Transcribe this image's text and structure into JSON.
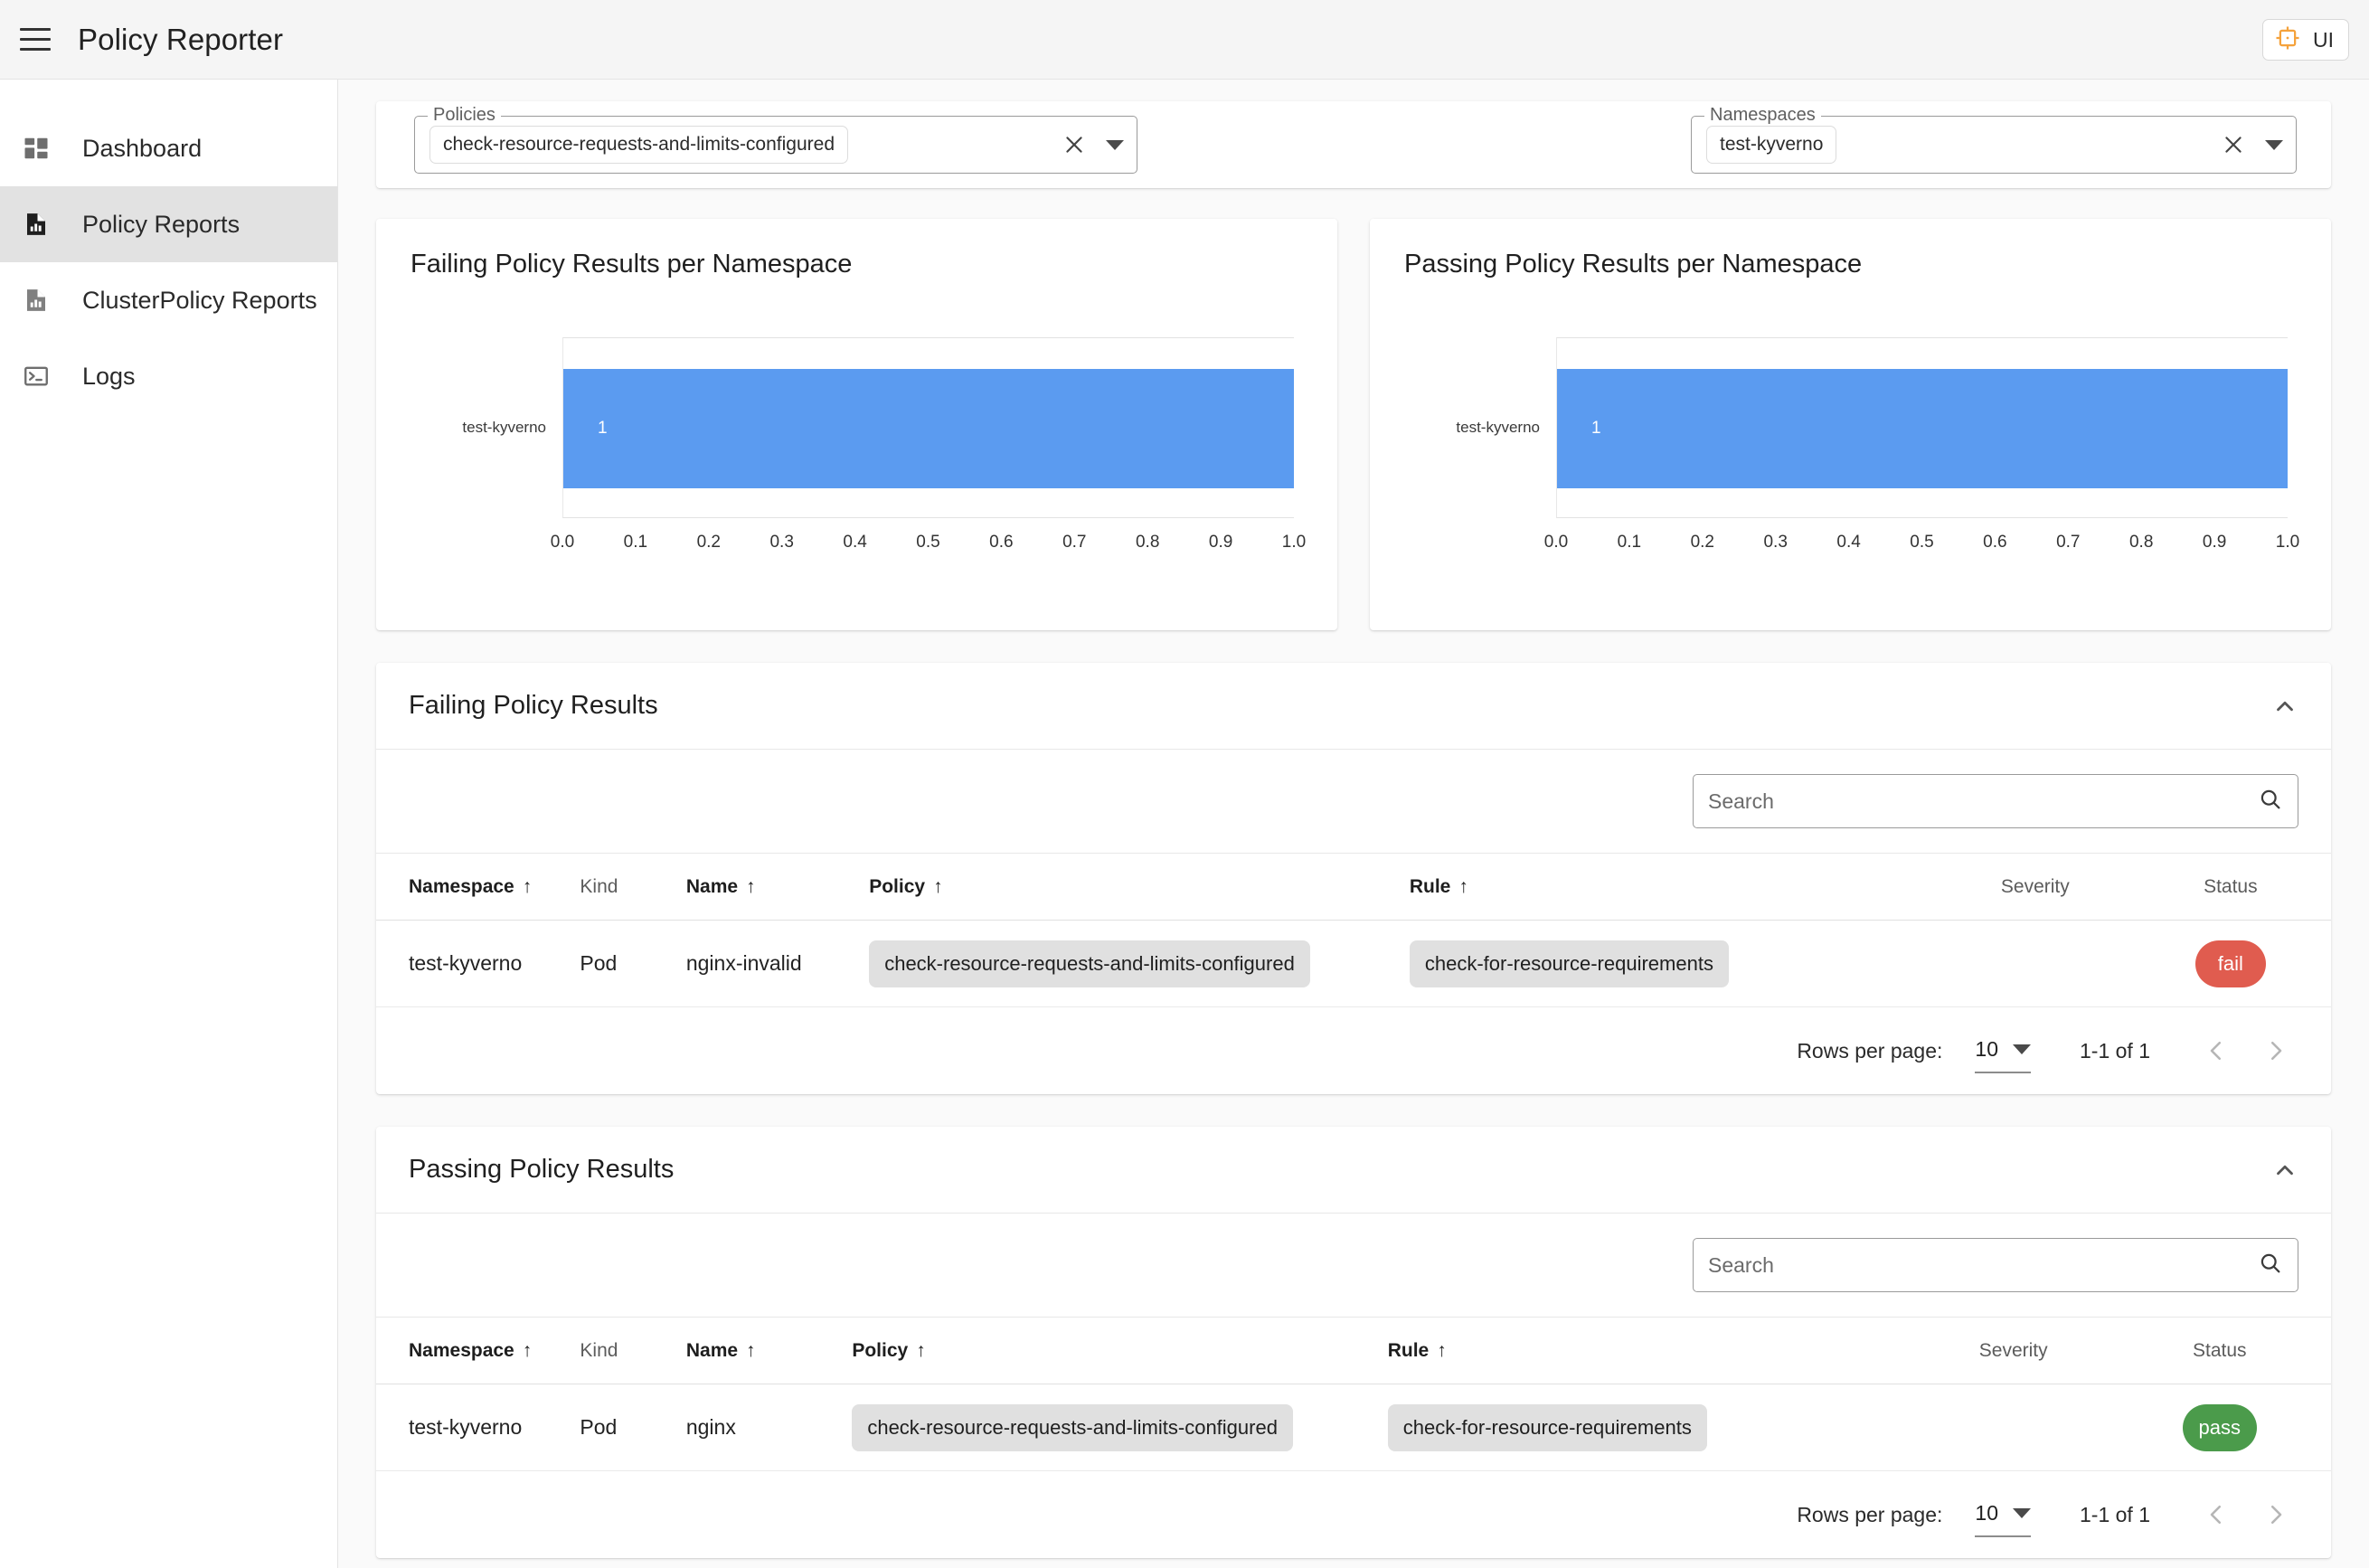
{
  "header": {
    "title": "Policy Reporter",
    "menu_icon": "hamburger-menu-icon",
    "ui_button_label": "UI"
  },
  "sidebar": {
    "items": [
      {
        "label": "Dashboard",
        "icon": "dashboard-grid-icon",
        "active": false
      },
      {
        "label": "Policy Reports",
        "icon": "policy-report-icon",
        "active": true
      },
      {
        "label": "ClusterPolicy Reports",
        "icon": "cluster-policy-report-icon",
        "active": false
      },
      {
        "label": "Logs",
        "icon": "terminal-icon",
        "active": false
      }
    ]
  },
  "filters": {
    "policies": {
      "legend": "Policies",
      "selected": [
        "check-resource-requests-and-limits-configured"
      ]
    },
    "namespaces": {
      "legend": "Namespaces",
      "selected": [
        "test-kyverno"
      ]
    }
  },
  "chart_data": [
    {
      "type": "bar",
      "orientation": "horizontal",
      "title": "Failing Policy Results per Namespace",
      "categories": [
        "test-kyverno"
      ],
      "values": [
        1
      ],
      "data_labels": [
        "1"
      ],
      "xlabel": "",
      "ylabel": "",
      "xlim": [
        0,
        1
      ],
      "xticks": [
        "0.0",
        "0.1",
        "0.2",
        "0.3",
        "0.4",
        "0.5",
        "0.6",
        "0.7",
        "0.8",
        "0.9",
        "1.0"
      ],
      "bar_color": "#5b9bf0",
      "grid": false,
      "legend": "none"
    },
    {
      "type": "bar",
      "orientation": "horizontal",
      "title": "Passing Policy Results per Namespace",
      "categories": [
        "test-kyverno"
      ],
      "values": [
        1
      ],
      "data_labels": [
        "1"
      ],
      "xlabel": "",
      "ylabel": "",
      "xlim": [
        0,
        1
      ],
      "xticks": [
        "0.0",
        "0.1",
        "0.2",
        "0.3",
        "0.4",
        "0.5",
        "0.6",
        "0.7",
        "0.8",
        "0.9",
        "1.0"
      ],
      "bar_color": "#5b9bf0",
      "grid": false,
      "legend": "none"
    }
  ],
  "failing_section": {
    "title": "Failing Policy Results",
    "search_placeholder": "Search",
    "search_value": "",
    "columns": [
      "Namespace",
      "Kind",
      "Name",
      "Policy",
      "Rule",
      "Severity",
      "Status"
    ],
    "sortable": [
      true,
      false,
      true,
      true,
      true,
      false,
      false
    ],
    "rows": [
      {
        "namespace": "test-kyverno",
        "kind": "Pod",
        "name": "nginx-invalid",
        "policy": "check-resource-requests-and-limits-configured",
        "rule": "check-for-resource-requirements",
        "severity": "",
        "status": "fail"
      }
    ],
    "pagination": {
      "rows_per_page_label": "Rows per page:",
      "rows_per_page_value": "10",
      "range": "1-1 of 1"
    }
  },
  "passing_section": {
    "title": "Passing Policy Results",
    "search_placeholder": "Search",
    "search_value": "",
    "columns": [
      "Namespace",
      "Kind",
      "Name",
      "Policy",
      "Rule",
      "Severity",
      "Status"
    ],
    "sortable": [
      true,
      false,
      true,
      true,
      true,
      false,
      false
    ],
    "rows": [
      {
        "namespace": "test-kyverno",
        "kind": "Pod",
        "name": "nginx",
        "policy": "check-resource-requests-and-limits-configured",
        "rule": "check-for-resource-requirements",
        "severity": "",
        "status": "pass"
      }
    ],
    "pagination": {
      "rows_per_page_label": "Rows per page:",
      "rows_per_page_value": "10",
      "range": "1-1 of 1"
    }
  },
  "colors": {
    "bar_blue": "#5b9bf0",
    "fail_red": "#e05c4f",
    "pass_green": "#4b9b4b",
    "accent_orange": "#f5a23c",
    "active_nav": "#e2e2e2"
  }
}
